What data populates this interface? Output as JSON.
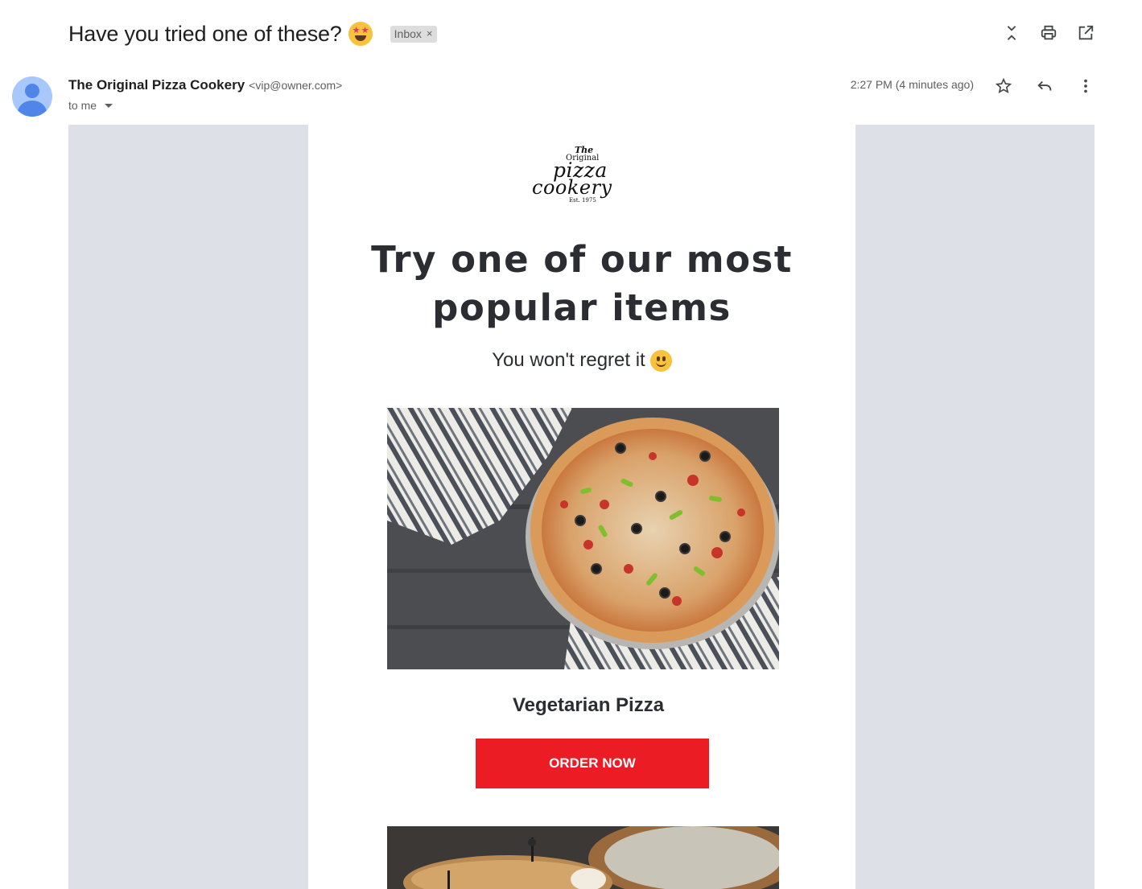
{
  "email": {
    "subject": "Have you tried one of these?",
    "label_chip": "Inbox",
    "label_chip_close": "×",
    "sender_name": "The Original Pizza Cookery",
    "sender_email": "<vip@owner.com>",
    "recipient": "to me",
    "timestamp": "2:27 PM (4 minutes ago)"
  },
  "toolbar_icons": [
    "collapse-all-icon",
    "print-icon",
    "open-in-new-window-icon"
  ],
  "message_icons": [
    "star-icon",
    "reply-icon",
    "more-options-icon"
  ],
  "newsletter": {
    "logo": {
      "the": "The",
      "original": "Original",
      "pizza": "pizza",
      "cookery": "cookery",
      "est": "Est. 1975"
    },
    "headline_line1": "Try one of our most",
    "headline_line2": "popular items",
    "subline": "You won't regret it",
    "featured_item": {
      "name": "Vegetarian Pizza",
      "cta": "ORDER NOW"
    }
  },
  "colors": {
    "gutter": "#dde0e6",
    "cta": "#ec1c24",
    "headline": "#2b2d33",
    "avatar": "#a8c7fa"
  }
}
